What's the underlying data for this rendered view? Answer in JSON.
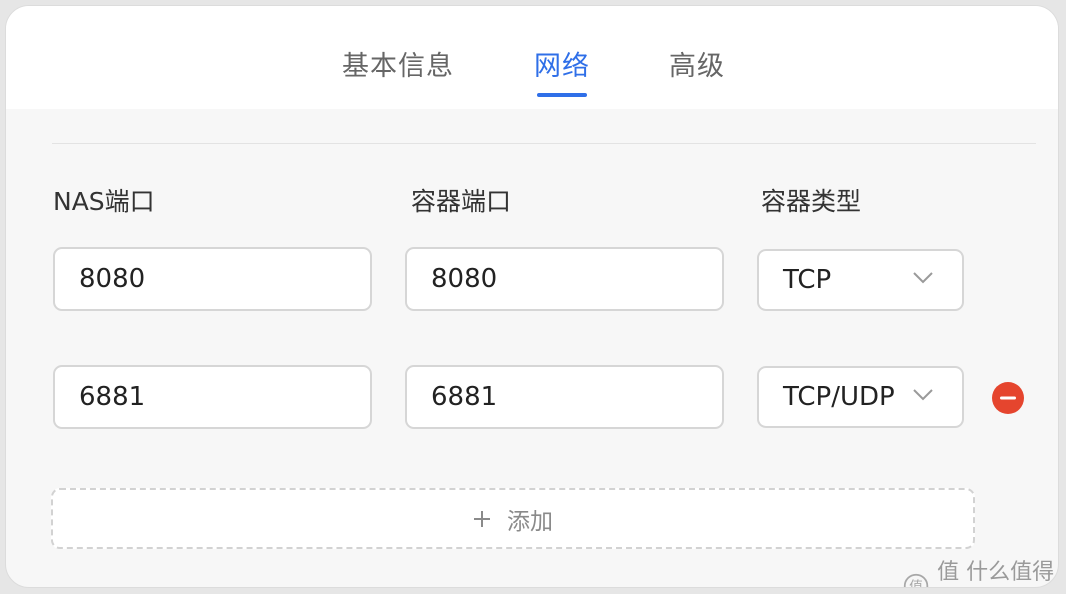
{
  "tabs": [
    {
      "label": "基本信息",
      "active": false
    },
    {
      "label": "网络",
      "active": true
    },
    {
      "label": "高级",
      "active": false
    }
  ],
  "columns": {
    "nas_port": "NAS端口",
    "container_port": "容器端口",
    "container_type": "容器类型"
  },
  "rows": [
    {
      "nas_port": "8080",
      "container_port": "8080",
      "type": "TCP",
      "removable": false
    },
    {
      "nas_port": "6881",
      "container_port": "6881",
      "type": "TCP/UDP",
      "removable": true
    }
  ],
  "add_button": {
    "label": "添加",
    "icon": "plus-icon"
  },
  "watermark": {
    "text": "值 什么值得买",
    "icon": "smzdm-logo"
  },
  "colors": {
    "accent": "#2f6fe8",
    "remove": "#e5452e",
    "text": "#222222",
    "muted": "#8a8a8a"
  }
}
